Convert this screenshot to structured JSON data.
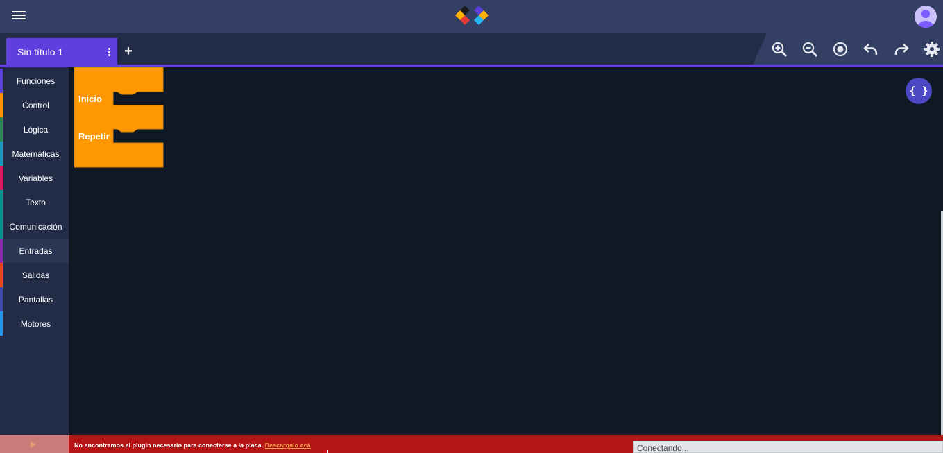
{
  "header": {
    "menu_icon": "hamburger-menu-icon",
    "logo_icon": "diamond-logo-icon",
    "avatar_icon": "user-avatar-icon"
  },
  "tabs": [
    {
      "label": "Sin título 1",
      "active": true
    }
  ],
  "toolbar": {
    "icons": [
      "zoom-in-icon",
      "zoom-out-icon",
      "recenter-icon",
      "undo-icon",
      "redo-icon",
      "settings-icon"
    ]
  },
  "sidebar": {
    "categories": [
      {
        "label": "Funciones",
        "color": "#5b3fde"
      },
      {
        "label": "Control",
        "color": "#ff9800"
      },
      {
        "label": "Lógica",
        "color": "#2e8b57"
      },
      {
        "label": "Matemáticas",
        "color": "#1b9bc2"
      },
      {
        "label": "Variables",
        "color": "#d81b60"
      },
      {
        "label": "Texto",
        "color": "#00968f"
      },
      {
        "label": "Comunicación",
        "color": "#00968f"
      },
      {
        "label": "Entradas",
        "color": "#8e24aa",
        "active": true
      },
      {
        "label": "Salidas",
        "color": "#e64a19"
      },
      {
        "label": "Pantallas",
        "color": "#3949ab"
      },
      {
        "label": "Motores",
        "color": "#2196f3"
      }
    ]
  },
  "workspace": {
    "block": {
      "color": "#ff9800",
      "inputs": [
        "Inicio",
        "Repetir"
      ]
    },
    "code_button_label": "{ }"
  },
  "footer": {
    "notice_text": "No encontramos el plugin necesario para conectarse a la placa.",
    "notice_link": "Descargalo acá",
    "status": "Conectando...",
    "run_icon": "play-icon"
  }
}
